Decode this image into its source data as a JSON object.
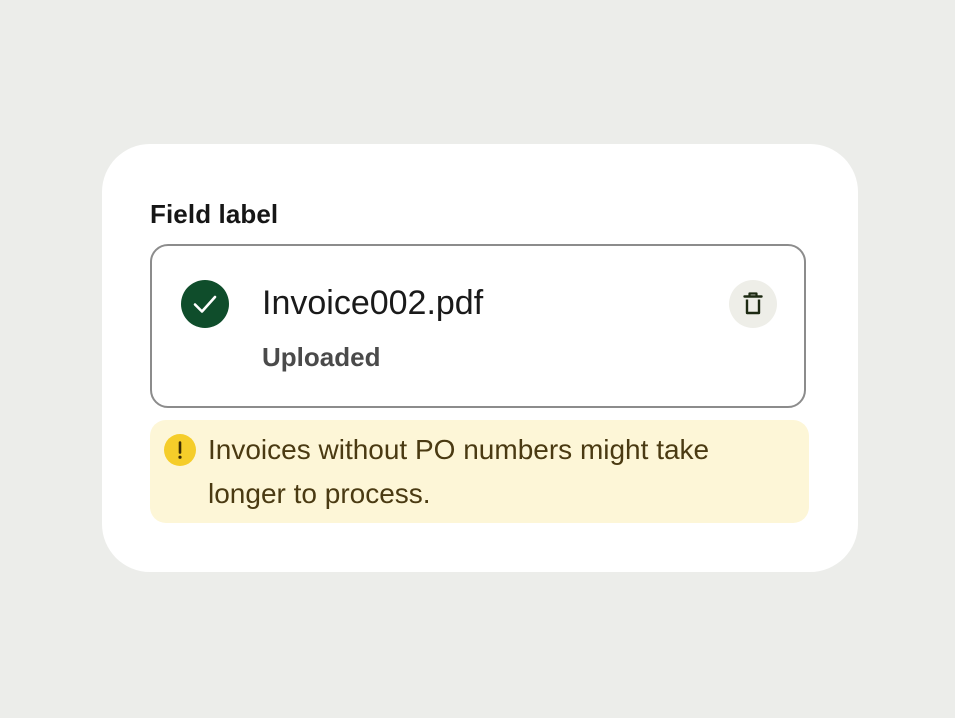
{
  "field": {
    "label": "Field label"
  },
  "file": {
    "name": "Invoice002.pdf",
    "status": "Uploaded",
    "status_icon": "check-circle-icon",
    "delete_icon": "trash-icon"
  },
  "warning": {
    "icon": "exclamation-icon",
    "message": "Invoices without PO numbers might take longer to process."
  },
  "colors": {
    "success": "#0f4d2b",
    "warning_icon": "#f5cd2a",
    "warning_bg": "#fdf6d7",
    "page_bg": "#ecedea"
  }
}
